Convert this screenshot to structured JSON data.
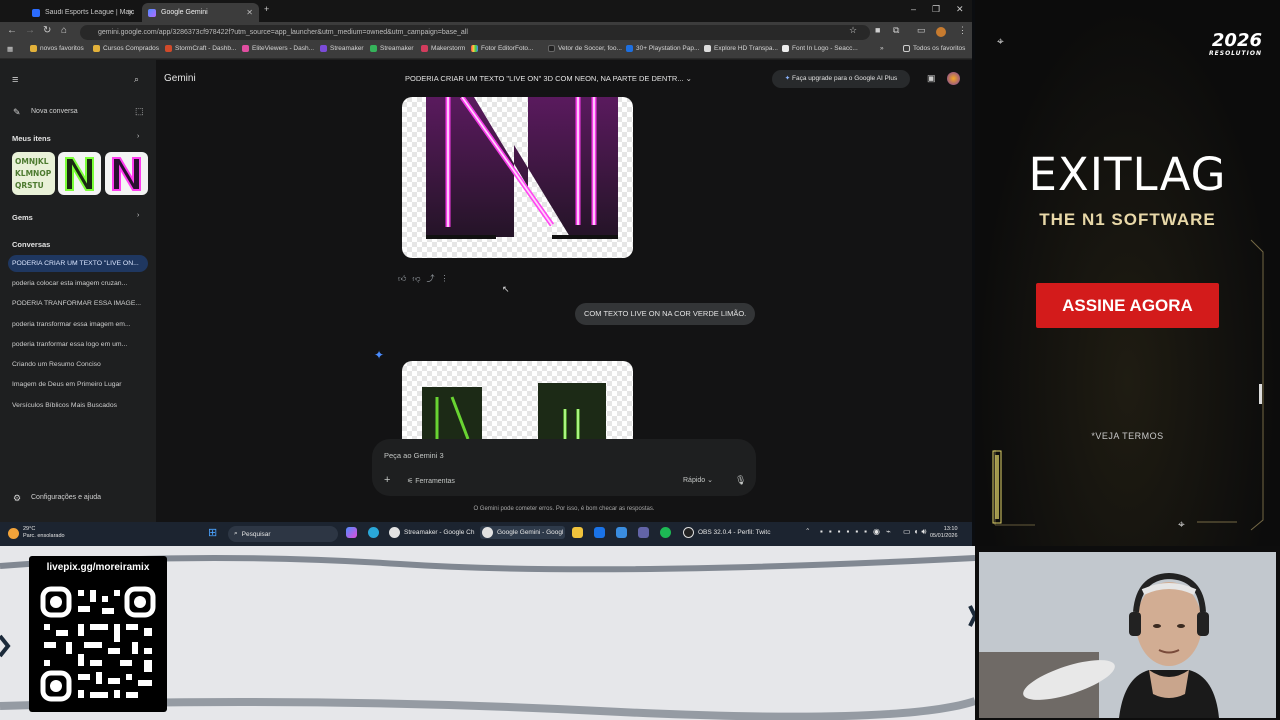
{
  "browser": {
    "tabs": [
      {
        "label": "Saudi Esports League | Major 3"
      },
      {
        "label": "Google Gemini"
      }
    ],
    "url": "gemini.google.com/app/3286373cf978422f?utm_source=app_launcher&utm_medium=owned&utm_campaign=base_all",
    "bookmarks": [
      "novos favoritos",
      "Cursos Comprados",
      "StormCraft - Dashb...",
      "EliteViewers - Dash...",
      "Streamaker",
      "Streamaker",
      "Makerstorm",
      "Fotor Editor",
      "Foto...",
      "Vetor de Soccer, foo...",
      "30+ Playstation Pap...",
      "Explore HD Transpa...",
      "Font In Logo - Seacc..."
    ],
    "all_bookmarks": "Todos os favoritos"
  },
  "gemini": {
    "app_name": "Gemini",
    "new_chat": "Nova conversa",
    "my_items": "Meus itens",
    "gems": "Gems",
    "conversations_heading": "Conversas",
    "conversations": [
      "PODERIA CRIAR UM TEXTO \"LIVE ON...",
      "poderia colocar esta imagem cruzan...",
      "PODERIA TRANFORMAR ESSA IMAGE...",
      "poderia transformar essa imagem em...",
      "poderia tranformar essa logo em um...",
      "Criando um Resumo Conciso",
      "Imagem de Deus em Primeiro Lugar",
      "Versículos Bíblicos Mais Buscados"
    ],
    "settings": "Configurações e ajuda",
    "chat_title": "PODERIA CRIAR UM TEXTO \"LIVE ON\" 3D COM NEON, NA PARTE DE DENTR...",
    "upgrade": "Faça upgrade para o Google AI Plus",
    "user_message": "COM TEXTO LIVE ON NA COR VERDE LIMÃO.",
    "input_placeholder": "Peça ao Gemini 3",
    "tools": "Ferramentas",
    "mode": "Rápido",
    "disclaimer": "O Gemini pode cometer erros. Por isso, é bom checar as respostas.",
    "thumb_text": "OMNJKL\nKLMNOP\nQRSTU"
  },
  "taskbar": {
    "weather_temp": "29°C",
    "weather_desc": "Parc. ensolarado",
    "search": "Pesquisar",
    "apps": [
      "Streamaker - Google Ch",
      "Google Gemini - Googl",
      "OBS 32.0.4 - Perfil: Twitc"
    ],
    "time": "13:10",
    "date": "05/01/2026"
  },
  "ad": {
    "logo_year": "2026",
    "logo_sub": "RESOLUTION",
    "brand": "EXITLAG",
    "tagline": "THE N1 SOFTWARE",
    "cta": "ASSINE AGORA",
    "terms": "*VEJA TERMOS"
  },
  "stream": {
    "qr_url": "livepix.gg/moreiramix"
  },
  "colors": {
    "accent_blue": "#1f3760",
    "neon_pink": "#ff3df0",
    "neon_green": "#7dff3a",
    "cta_red": "#d31b1b"
  }
}
